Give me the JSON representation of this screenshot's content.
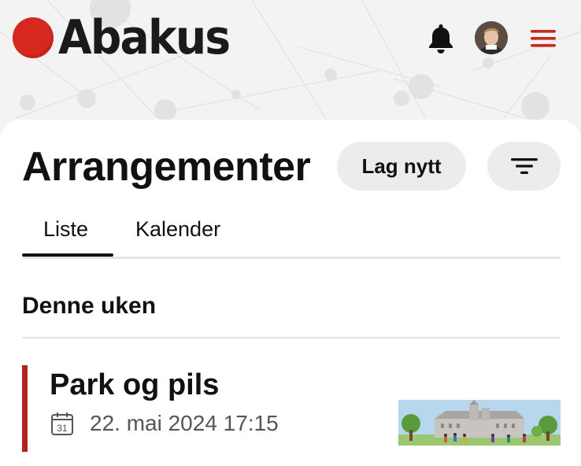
{
  "header": {
    "logo_text": "Abakus",
    "icons": [
      "notification-bell-icon",
      "user-avatar",
      "hamburger-menu-icon"
    ],
    "accent_color": "#d6281e"
  },
  "page": {
    "title": "Arrangementer",
    "create_button": "Lag nytt",
    "filter_button_icon": "filter-icon"
  },
  "tabs": [
    {
      "label": "Liste",
      "active": true
    },
    {
      "label": "Kalender",
      "active": false
    }
  ],
  "sections": [
    {
      "heading": "Denne uken",
      "events": [
        {
          "title": "Park og pils",
          "date": "22. mai 2024 17:15",
          "calendar_icon_day": "31",
          "color": "#b3231d"
        }
      ]
    }
  ]
}
